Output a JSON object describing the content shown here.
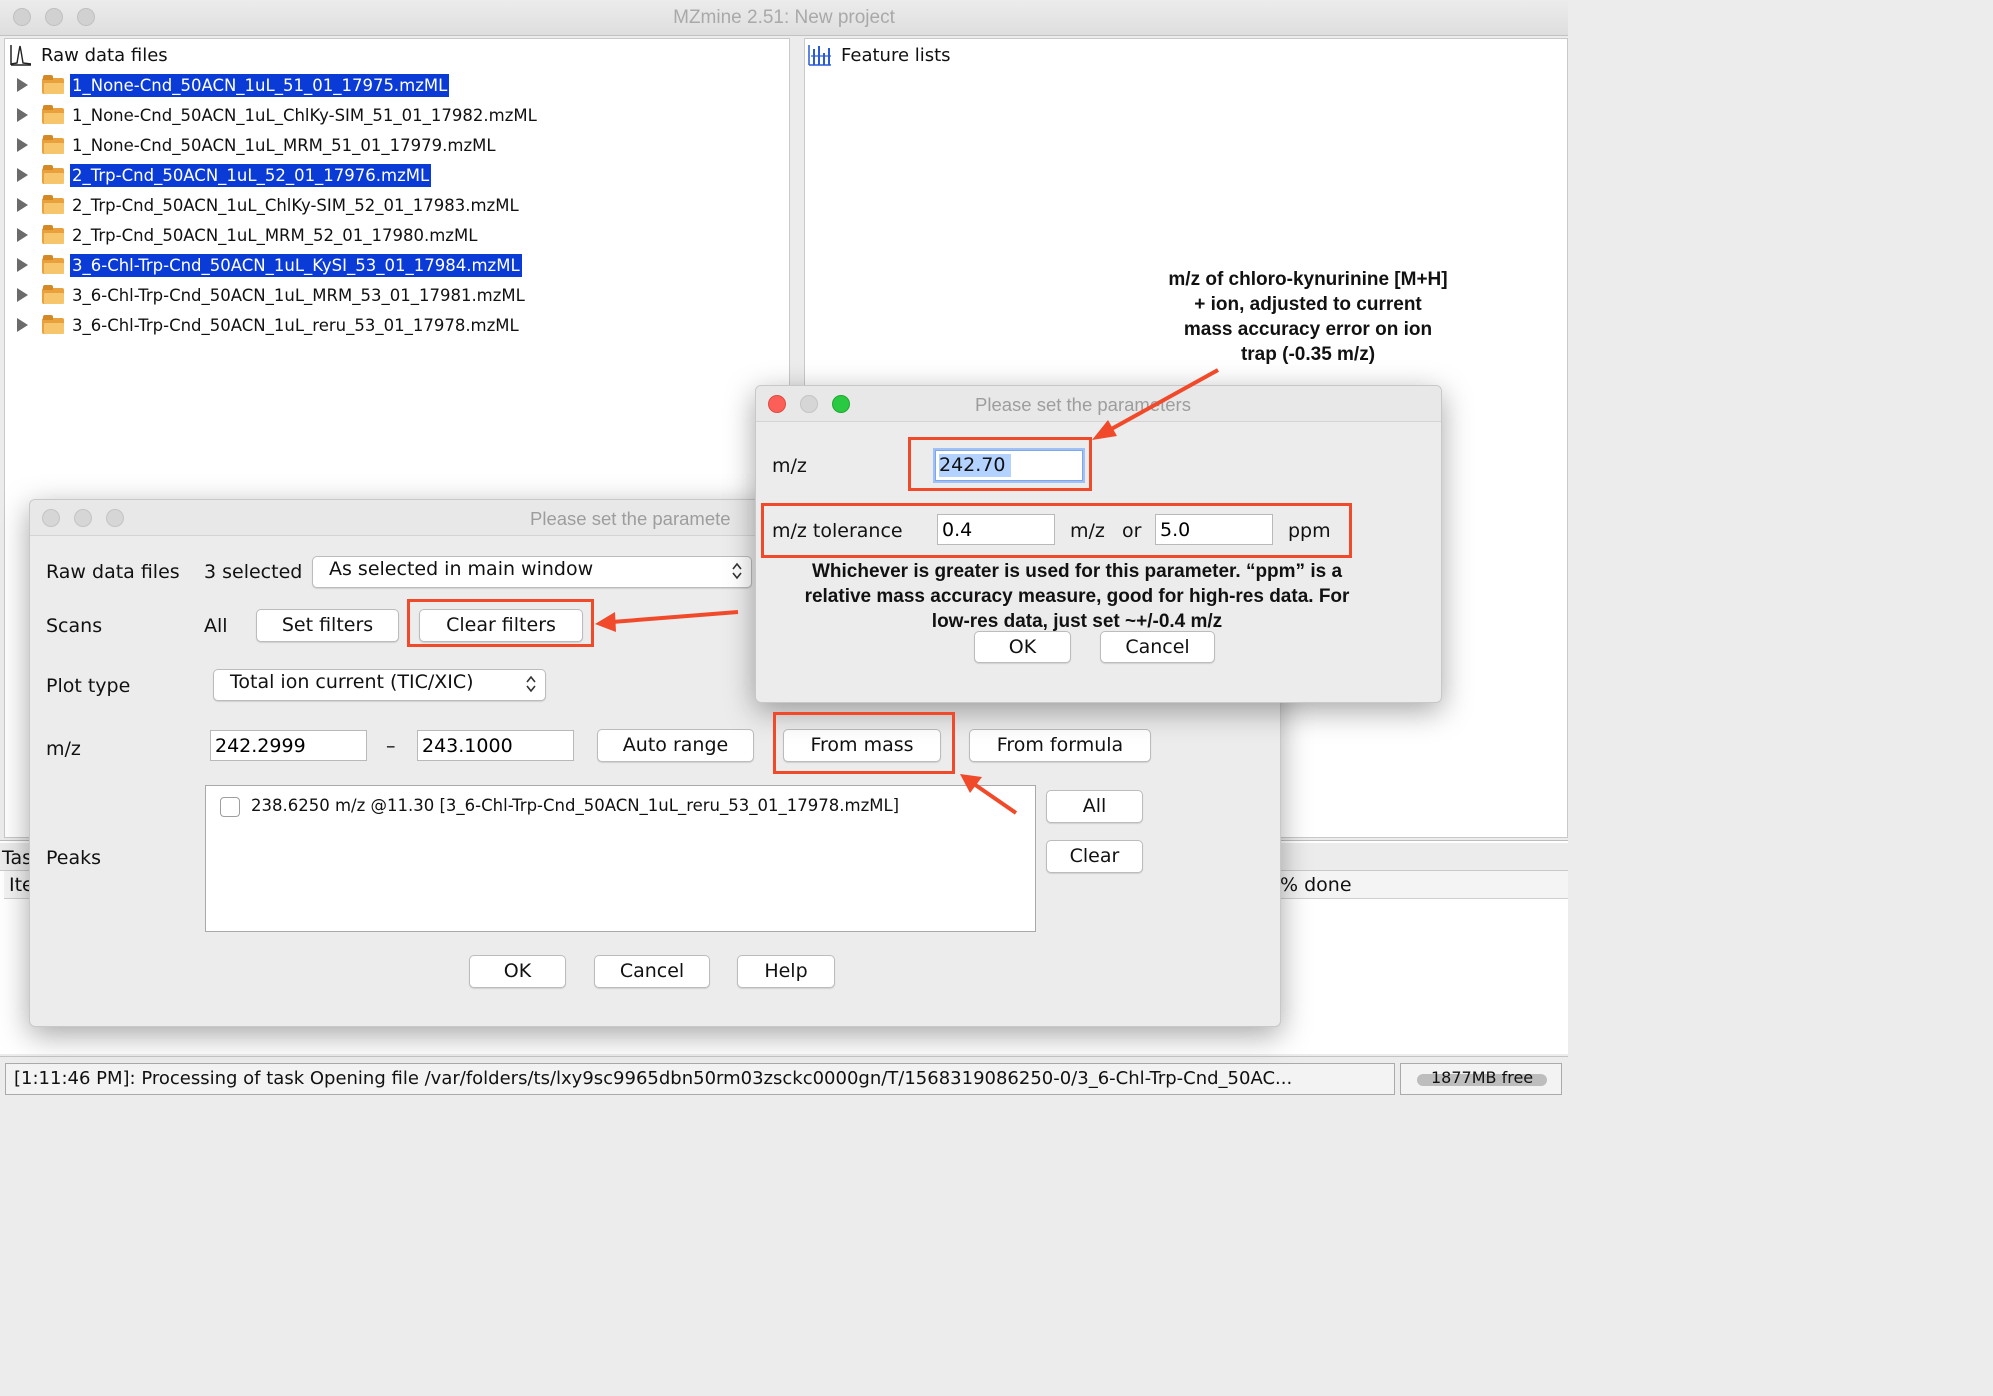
{
  "window": {
    "title": "MZmine 2.51: New project"
  },
  "raw_panel": {
    "header": "Raw data files",
    "files": [
      {
        "name": "1_None-Cnd_50ACN_1uL_51_01_17975.mzML",
        "selected": true
      },
      {
        "name": "1_None-Cnd_50ACN_1uL_ChlKy-SIM_51_01_17982.mzML",
        "selected": false
      },
      {
        "name": "1_None-Cnd_50ACN_1uL_MRM_51_01_17979.mzML",
        "selected": false
      },
      {
        "name": "2_Trp-Cnd_50ACN_1uL_52_01_17976.mzML",
        "selected": true
      },
      {
        "name": "2_Trp-Cnd_50ACN_1uL_ChlKy-SIM_52_01_17983.mzML",
        "selected": false
      },
      {
        "name": "2_Trp-Cnd_50ACN_1uL_MRM_52_01_17980.mzML",
        "selected": false
      },
      {
        "name": "3_6-Chl-Trp-Cnd_50ACN_1uL_KySI_53_01_17984.mzML",
        "selected": true
      },
      {
        "name": "3_6-Chl-Trp-Cnd_50ACN_1uL_MRM_53_01_17981.mzML",
        "selected": false
      },
      {
        "name": "3_6-Chl-Trp-Cnd_50ACN_1uL_reru_53_01_17978.mzML",
        "selected": false
      }
    ]
  },
  "feature_panel": {
    "header": "Feature lists"
  },
  "task_panel": {
    "tab_fragment": "Tas",
    "col_item_fragment": "Ite",
    "col_done": "% done"
  },
  "status_bar": {
    "message": "[1:11:46 PM]: Processing of task Opening file /var/folders/ts/lxy9sc9965dbn50rm03zsckc0000gn/T/1568319086250-0/3_6-Chl-Trp-Cnd_50AC...",
    "memory": "1877MB free"
  },
  "chrom_dialog": {
    "title": "Please set the paramete",
    "raw_label": "Raw data files",
    "raw_count": "3 selected",
    "raw_select": "As selected in main window",
    "scans_label": "Scans",
    "scans_value": "All",
    "set_filters": "Set filters",
    "clear_filters": "Clear filters",
    "plot_type_label": "Plot type",
    "plot_type_value": "Total ion current (TIC/XIC)",
    "mz_label": "m/z",
    "mz_min": "242.2999",
    "mz_dash": "–",
    "mz_max": "243.1000",
    "auto_range": "Auto range",
    "from_mass": "From mass",
    "from_formula": "From formula",
    "peaks_label": "Peaks",
    "peak_item": "238.6250 m/z @11.30 [3_6-Chl-Trp-Cnd_50ACN_1uL_reru_53_01_17978.mzML]",
    "all": "All",
    "clear": "Clear",
    "ok": "OK",
    "cancel": "Cancel",
    "help": "Help"
  },
  "mass_dialog": {
    "title": "Please set the parameters",
    "mz_label": "m/z",
    "mz_value": "242.70",
    "tol_label": "m/z tolerance",
    "tol_mz": "0.4",
    "tol_unit": "m/z",
    "tol_or": "or",
    "tol_ppm": "5.0",
    "ppm_unit": "ppm",
    "ok": "OK",
    "cancel": "Cancel"
  },
  "annotations": {
    "top_note": [
      "m/z of chloro-kynurinine [M+H]",
      "+ ion, adjusted to current",
      "mass accuracy error on ion",
      "trap (-0.35 m/z)"
    ],
    "mid_note": [
      "Whichever is greater is used for this parameter. “ppm” is a",
      "relative mass accuracy measure, good for high-res data. For",
      "low-res data, just set ~+/-0.4 m/z"
    ],
    "color": "#f04a2b"
  }
}
